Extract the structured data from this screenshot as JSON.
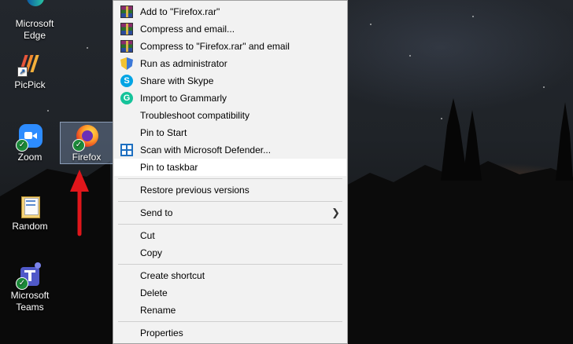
{
  "desktop": {
    "icons": [
      {
        "label": "Microsoft Edge",
        "icon": "edge-icon"
      },
      {
        "label": "PicPick",
        "icon": "picpick-icon"
      },
      {
        "label": "Zoom",
        "icon": "zoom-icon"
      },
      {
        "label": "Firefox",
        "icon": "firefox-icon"
      },
      {
        "label": "Random",
        "icon": "folder-icon"
      },
      {
        "label": "Microsoft Teams",
        "icon": "teams-icon"
      }
    ]
  },
  "context_menu": {
    "items": [
      {
        "label": "Add to \"Firefox.rar\"",
        "icon": "winrar-icon"
      },
      {
        "label": "Compress and email...",
        "icon": "winrar-icon"
      },
      {
        "label": "Compress to \"Firefox.rar\" and email",
        "icon": "winrar-icon"
      },
      {
        "label": "Run as administrator",
        "icon": "uac-shield-icon"
      },
      {
        "label": "Share with Skype",
        "icon": "skype-icon"
      },
      {
        "label": "Import to Grammarly",
        "icon": "grammarly-icon"
      },
      {
        "label": "Troubleshoot compatibility",
        "icon": ""
      },
      {
        "label": "Pin to Start",
        "icon": ""
      },
      {
        "label": "Scan with Microsoft Defender...",
        "icon": "defender-icon"
      },
      {
        "label": "Pin to taskbar",
        "icon": "",
        "highlighted": true
      },
      {
        "label": "Restore previous versions",
        "icon": ""
      },
      {
        "label": "Send to",
        "icon": "",
        "submenu": true
      },
      {
        "label": "Cut",
        "icon": ""
      },
      {
        "label": "Copy",
        "icon": ""
      },
      {
        "label": "Create shortcut",
        "icon": ""
      },
      {
        "label": "Delete",
        "icon": ""
      },
      {
        "label": "Rename",
        "icon": ""
      },
      {
        "label": "Properties",
        "icon": ""
      }
    ]
  },
  "colors": {
    "annotation_arrow": "#e0161b",
    "menu_bg": "#f2f2f2",
    "highlight_bg": "#ffffff"
  }
}
